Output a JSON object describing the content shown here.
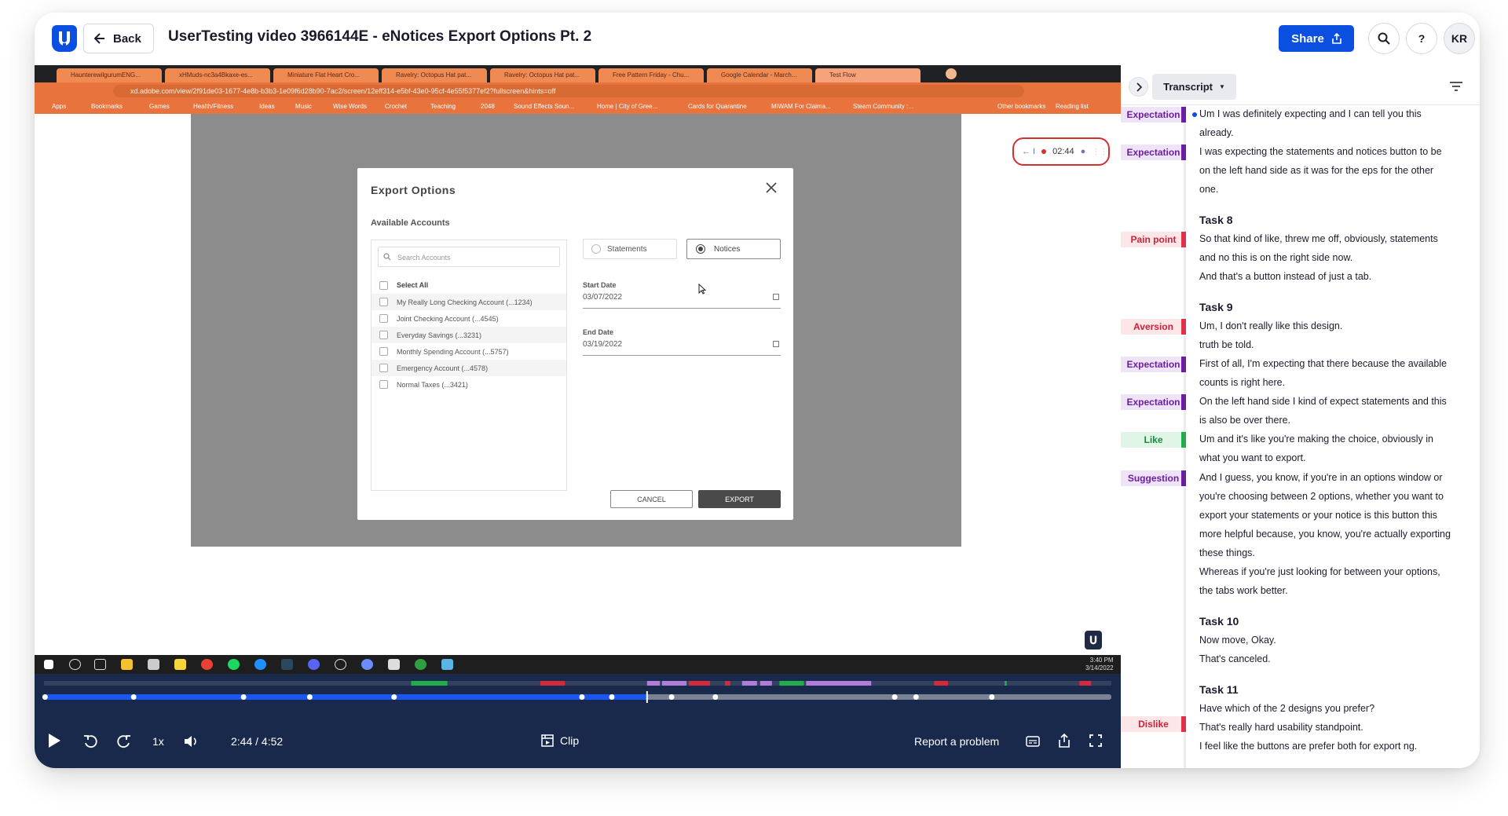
{
  "header": {
    "back_label": "Back",
    "title": "UserTesting video 3966144E - eNotices Export Options Pt. 2",
    "share_label": "Share",
    "help_label": "?",
    "avatar_initials": "KR"
  },
  "browser": {
    "tabs": [
      "HaunterewilgurumENG...",
      "xHMuds-nc3a4Bkaxe-es...",
      "Miniature Flat Heart Cro...",
      "Ravelry: Octopus Hat pat...",
      "Ravelry: Octopus Hat pat...",
      "Free Pattern Friday - Chu...",
      "Google Calendar - March...",
      "Test Flow"
    ],
    "url": "xd.adobe.com/view/2f91de03-1677-4e8b-b3b3-1e09f6d28b90-7ac2/screen/12eff314-e5bf-43e0-95cf-4e55f5377ef2?fullscreen&hints=off",
    "bookmarks": [
      "Apps",
      "Bookmarks",
      "Games",
      "Health/Fitness",
      "Ideas",
      "Music",
      "Wise Words",
      "Crochet",
      "Teaching",
      "2048",
      "Sound Effects Soun...",
      "Home | City of Gree...",
      "Cards for Quarantine",
      "MiWAM For Claima...",
      "Steam Community :...",
      "Other bookmarks",
      "Reading list"
    ]
  },
  "recorder": {
    "back": "← I",
    "time": "02:44"
  },
  "modal": {
    "title": "Export Options",
    "section": "Available Accounts",
    "search_placeholder": "Search Accounts",
    "select_all": "Select All",
    "accounts": [
      "My Really Long Checking Account (...1234)",
      "Joint Checking Account (...4545)",
      "Everyday Savings (...3231)",
      "Monthly Spending Account (...5757)",
      "Emergency Account (...4578)",
      "Normal Taxes (...3421)"
    ],
    "radio_statements": "Statements",
    "radio_notices": "Notices",
    "selected_radio": "Notices",
    "start_label": "Start Date",
    "start_value": "03/07/2022",
    "end_label": "End Date",
    "end_value": "03/19/2022",
    "cancel": "CANCEL",
    "export": "EXPORT"
  },
  "taskbar": {
    "time": "3:40 PM",
    "date": "3/14/2022"
  },
  "player": {
    "speed": "1x",
    "time": "2:44 / 4:52",
    "clip": "Clip",
    "report": "Report a problem",
    "progress": 0.565
  },
  "timeline": {
    "colors": {
      "green": "#1fae4a",
      "red": "#d42a3c",
      "purple": "#b07cd8",
      "violet": "#7a1fb0"
    },
    "segments": [
      {
        "start": 0.344,
        "end": 0.378,
        "color": "green"
      },
      {
        "start": 0.465,
        "end": 0.488,
        "color": "red"
      },
      {
        "start": 0.565,
        "end": 0.577,
        "color": "purple"
      },
      {
        "start": 0.579,
        "end": 0.602,
        "color": "purple"
      },
      {
        "start": 0.604,
        "end": 0.624,
        "color": "red"
      },
      {
        "start": 0.638,
        "end": 0.643,
        "color": "red"
      },
      {
        "start": 0.654,
        "end": 0.668,
        "color": "purple"
      },
      {
        "start": 0.671,
        "end": 0.682,
        "color": "purple"
      },
      {
        "start": 0.689,
        "end": 0.712,
        "color": "green"
      },
      {
        "start": 0.714,
        "end": 0.775,
        "color": "purple"
      },
      {
        "start": 0.834,
        "end": 0.847,
        "color": "red"
      },
      {
        "start": 0.9,
        "end": 0.902,
        "color": "green"
      },
      {
        "start": 0.97,
        "end": 0.981,
        "color": "red"
      }
    ],
    "markers": [
      0.001,
      0.084,
      0.187,
      0.249,
      0.328,
      0.504,
      0.532,
      0.588,
      0.629,
      0.797,
      0.817,
      0.888
    ]
  },
  "transcript": {
    "dropdown_label": "Transcript",
    "tag_colors": {
      "Expectation": {
        "bg": "#efe3f7",
        "fg": "#6a1fa3",
        "bar": "#6a1fa3"
      },
      "Pain point": {
        "bg": "#fde6e8",
        "fg": "#c8233a",
        "bar": "#e0314a"
      },
      "Aversion": {
        "bg": "#fde6e8",
        "fg": "#c8233a",
        "bar": "#e0314a"
      },
      "Like": {
        "bg": "#e1f5e6",
        "fg": "#1a8a3c",
        "bar": "#1fae4a"
      },
      "Suggestion": {
        "bg": "#efe3f7",
        "fg": "#6a1fa3",
        "bar": "#6a1fa3"
      },
      "Dislike": {
        "bg": "#fde6e8",
        "fg": "#c8233a",
        "bar": "#e0314a"
      }
    },
    "tags": [
      "Expectation",
      "Expectation",
      "Pain point",
      "Aversion",
      "Expectation",
      "Expectation",
      "Like",
      "Suggestion",
      "Dislike"
    ],
    "tasks": [
      "Task 8",
      "Task 9",
      "Task 10",
      "Task 11"
    ],
    "lines": [
      "Um I was definitely expecting and I can tell you this",
      "already.",
      "I was expecting the statements and notices button to be",
      "on the left hand side as it was for the eps for the other",
      "one.",
      "So that kind of like, threw me off, obviously, statements",
      "and no this is on the right side now.",
      "And that's a button instead of just a tab.",
      "Um, I don't really like this design.",
      "truth be told.",
      "First of all, I'm expecting that there because the available",
      "counts is right here.",
      "On the left hand side I kind of expect statements and this",
      "is also be over there.",
      "Um and it's like you're making the choice, obviously in",
      "what you want to export.",
      "And I guess, you know, if you're in an options window or",
      "you're choosing between 2 options, whether you want to",
      "export your statements or your notice is this button this",
      "more helpful because, you know, you're actually exporting",
      "these things.",
      "Whereas if you're just looking for between your options,",
      "the tabs work better.",
      "Now move, Okay.",
      "That's canceled.",
      "Have which of the 2 designs you prefer?",
      "That's really hard usability standpoint.",
      "I feel like the buttons are prefer both for export ng."
    ]
  }
}
